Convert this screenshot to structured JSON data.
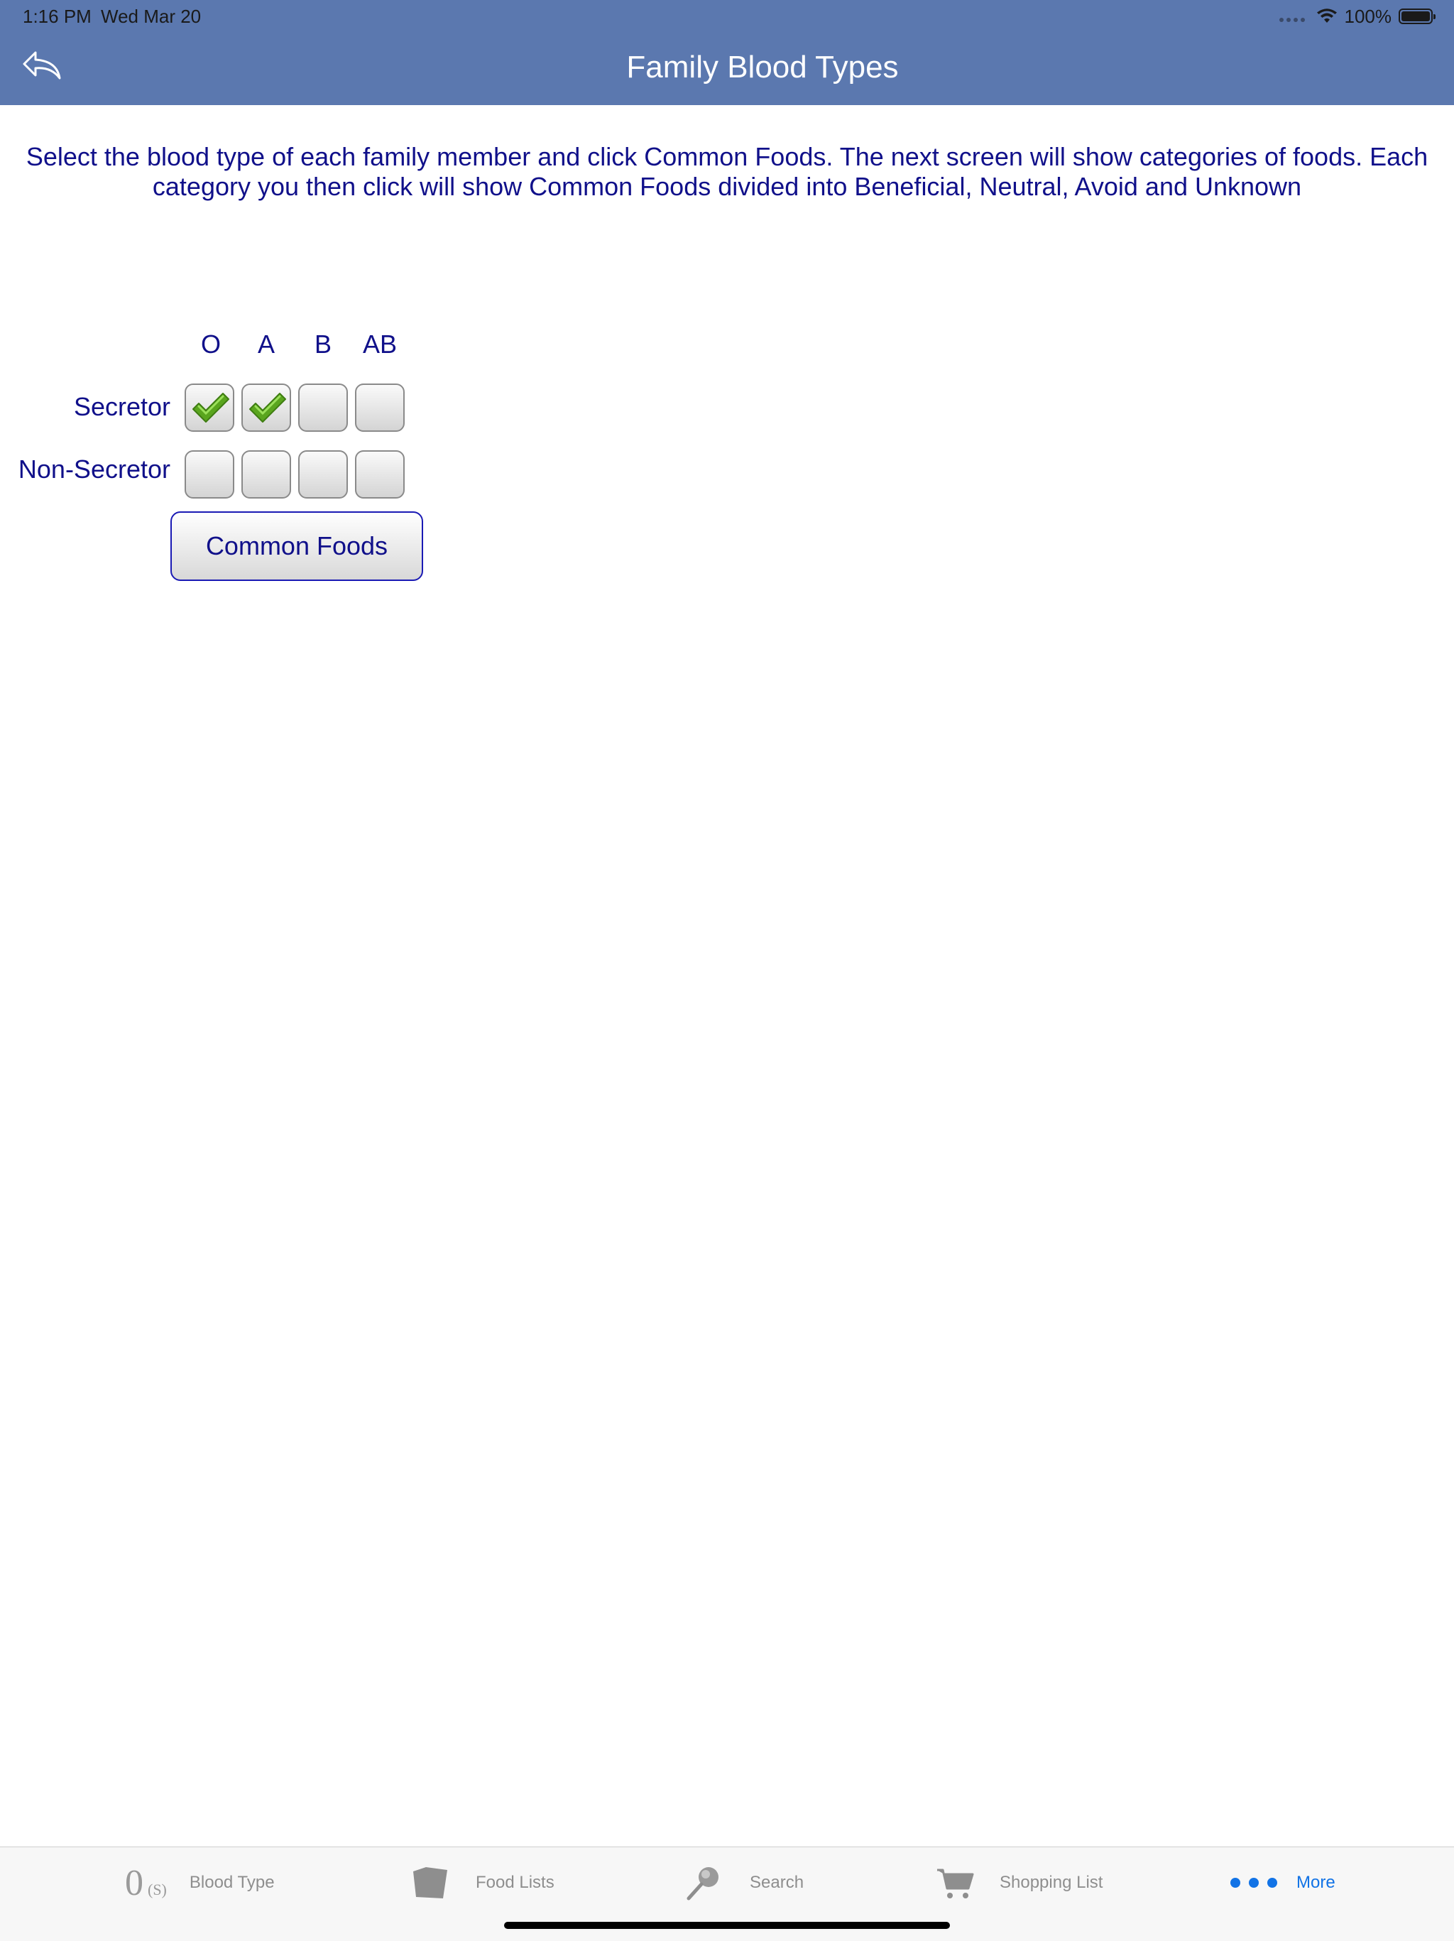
{
  "status_bar": {
    "time": "1:16 PM",
    "date": "Wed Mar 20",
    "battery": "100%"
  },
  "nav": {
    "title": "Family Blood Types"
  },
  "instructions": {
    "line1": "Select the blood type of each family member and click Common Foods.  The next screen will show categories of foods. Each",
    "line2": "category you then click will show Common Foods divided into Beneficial, Neutral, Avoid and Unknown"
  },
  "grid": {
    "columns": [
      "O",
      "A",
      "B",
      "AB"
    ],
    "rows": [
      {
        "label": "Secretor",
        "checked": [
          true,
          true,
          false,
          false
        ]
      },
      {
        "label": "Non-Secretor",
        "checked": [
          false,
          false,
          false,
          false
        ]
      }
    ]
  },
  "common_foods_label": "Common Foods",
  "tab_bar": {
    "blood_type_label": "Blood Type",
    "blood_type_badge_num": "0",
    "blood_type_badge_sub": "(S)",
    "food_lists_label": "Food Lists",
    "search_label": "Search",
    "shopping_list_label": "Shopping List",
    "more_label": "More",
    "inactive_color": "#8e8e8e",
    "active_color": "#1273e6"
  }
}
